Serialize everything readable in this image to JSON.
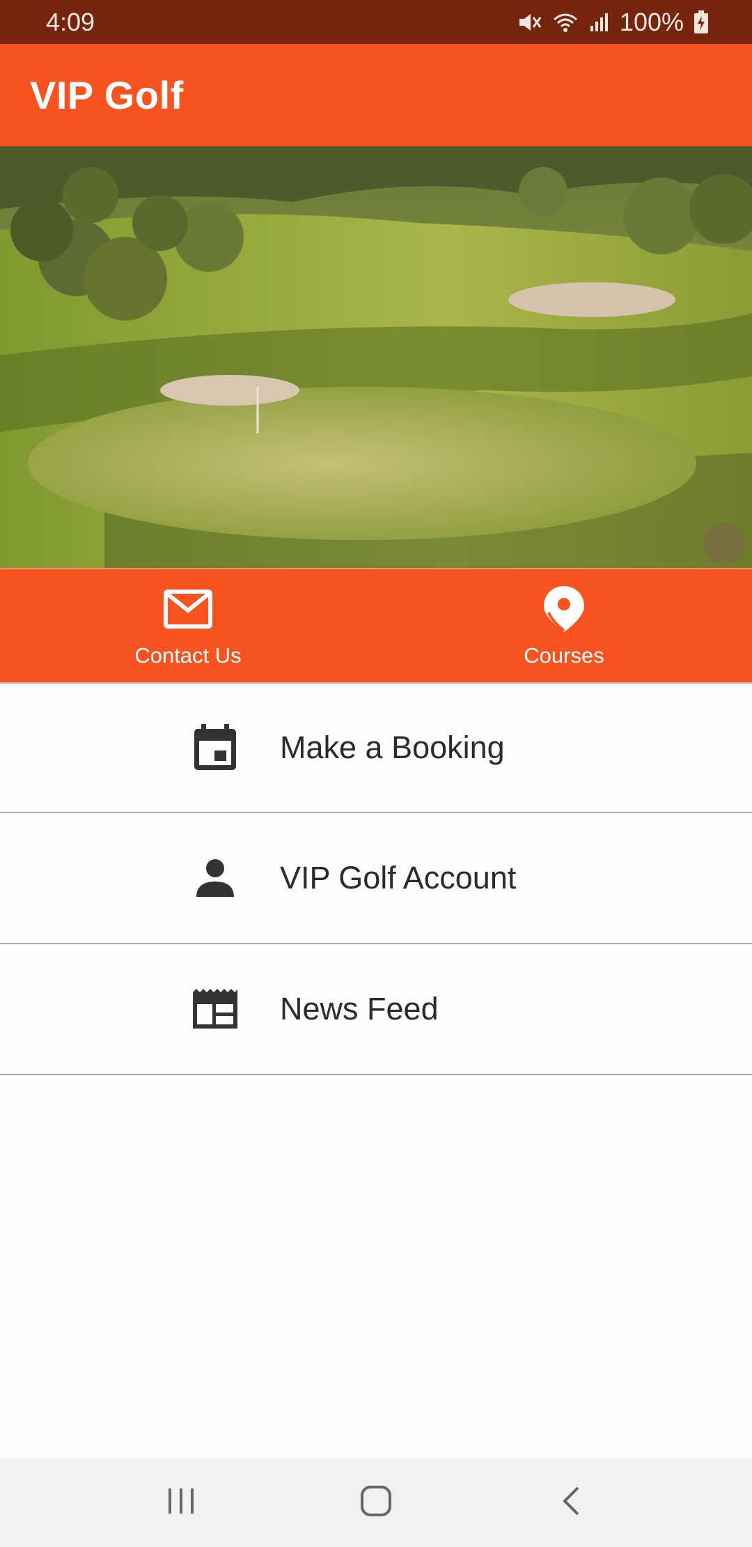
{
  "status_bar": {
    "time": "4:09",
    "battery": "100%",
    "icons": [
      "mute-icon",
      "wifi-icon",
      "signal-icon",
      "battery-charging-icon"
    ]
  },
  "app_bar": {
    "title": "VIP Golf"
  },
  "hero": {
    "description": "golf-course-photo"
  },
  "quick_actions": [
    {
      "label": "Contact Us",
      "icon": "mail-icon"
    },
    {
      "label": "Courses",
      "icon": "location-pin-icon"
    }
  ],
  "menu": {
    "items": [
      {
        "label": "Make a Booking",
        "icon": "calendar-icon"
      },
      {
        "label": "VIP Golf Account",
        "icon": "person-icon"
      },
      {
        "label": "News Feed",
        "icon": "newspaper-icon"
      }
    ]
  },
  "nav_bar": {
    "buttons": [
      "recent-apps-icon",
      "home-icon",
      "back-icon"
    ]
  },
  "colors": {
    "status_bar": "#76260f",
    "accent": "#f75321",
    "menu_text": "#2b2b2b",
    "divider": "#a8a8a8",
    "nav_bar": "#f1f1f1"
  }
}
